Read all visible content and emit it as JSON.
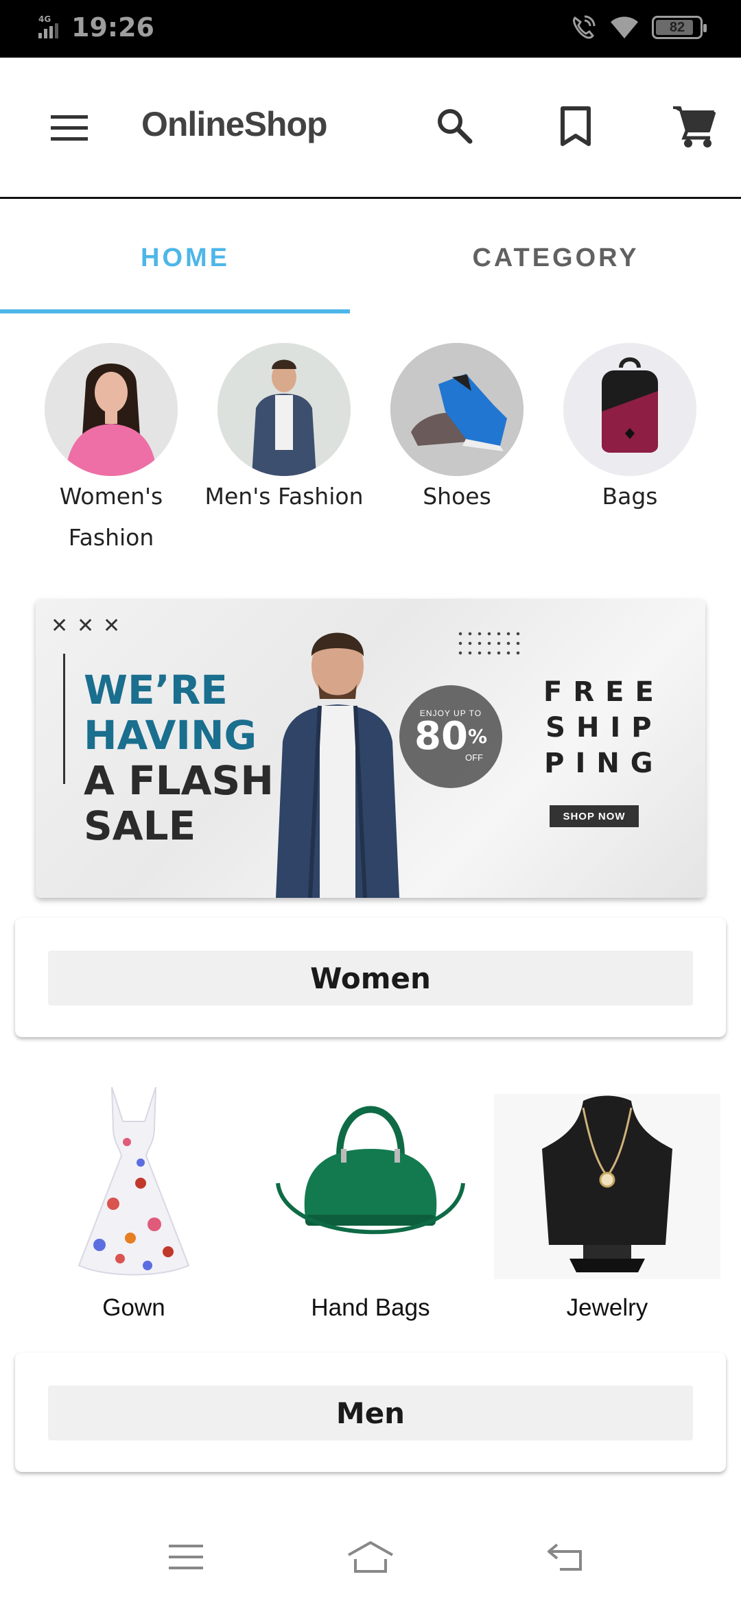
{
  "status_bar": {
    "network": "4G",
    "time": "19:26",
    "battery_level": "82"
  },
  "app_bar": {
    "title": "OnlineShop",
    "icons": [
      "menu-icon",
      "search-icon",
      "bookmark-icon",
      "cart-icon"
    ]
  },
  "tabs": [
    {
      "label": "HOME",
      "active": true
    },
    {
      "label": "CATEGORY",
      "active": false
    }
  ],
  "categories": [
    {
      "label": "Women's Fashion",
      "icon": "woman-portrait-icon"
    },
    {
      "label": "Men's Fashion",
      "icon": "man-portrait-icon"
    },
    {
      "label": "Shoes",
      "icon": "sneaker-icon"
    },
    {
      "label": "Bags",
      "icon": "backpack-icon"
    }
  ],
  "banner": {
    "headline_line1": "WE’RE",
    "headline_line2": "HAVING",
    "headline_line3": "A FLASH",
    "headline_line4": "SALE",
    "enjoy_text": "ENJOY UP TO",
    "discount": "80",
    "percent": "%",
    "off_text": "OFF",
    "free_line1": "FREE",
    "free_line2": "SHIP",
    "free_line3": "PING",
    "cta": "SHOP NOW",
    "accent_color": "#1a6e8e"
  },
  "sections": {
    "women": {
      "label": "Women",
      "products": [
        {
          "label": "Gown",
          "icon": "dress-icon"
        },
        {
          "label": "Hand Bags",
          "icon": "handbag-icon"
        },
        {
          "label": "Jewelry",
          "icon": "necklace-icon"
        }
      ]
    },
    "men": {
      "label": "Men"
    }
  },
  "colors": {
    "tab_active": "#4db6e8",
    "tab_inactive": "#616161",
    "title": "#424242"
  },
  "nav_bar": {
    "icons": [
      "recents-icon",
      "home-icon",
      "back-icon"
    ]
  }
}
